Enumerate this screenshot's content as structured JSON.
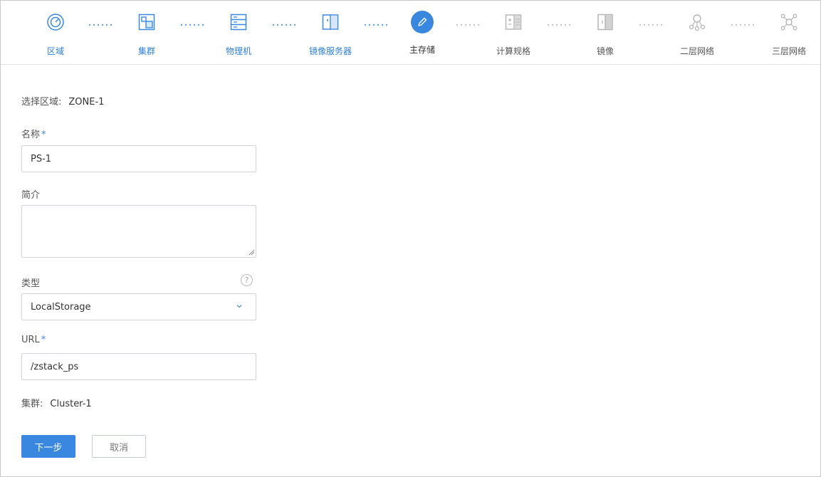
{
  "wizard": {
    "steps": [
      {
        "label": "区域",
        "icon": "zone-icon",
        "state": "done"
      },
      {
        "label": "集群",
        "icon": "cluster-icon",
        "state": "done"
      },
      {
        "label": "物理机",
        "icon": "host-icon",
        "state": "done"
      },
      {
        "label": "镜像服务器",
        "icon": "backup-storage-icon",
        "state": "done"
      },
      {
        "label": "主存储",
        "icon": "pencil-icon",
        "state": "current"
      },
      {
        "label": "计算规格",
        "icon": "instance-offering-icon",
        "state": "pending"
      },
      {
        "label": "镜像",
        "icon": "image-icon",
        "state": "pending"
      },
      {
        "label": "二层网络",
        "icon": "l2-network-icon",
        "state": "pending"
      },
      {
        "label": "三层网络",
        "icon": "l3-network-icon",
        "state": "pending"
      }
    ],
    "colors": {
      "active": "#3a87e0",
      "pending": "#b8b8b8"
    }
  },
  "form": {
    "zone": {
      "label": "选择区域:",
      "value": "ZONE-1"
    },
    "name": {
      "label": "名称",
      "required_mark": "*",
      "value": "PS-1"
    },
    "description": {
      "label": "简介",
      "value": ""
    },
    "type": {
      "label": "类型",
      "value": "LocalStorage",
      "help": "?"
    },
    "url": {
      "label": "URL",
      "required_mark": "*",
      "value": "/zstack_ps"
    },
    "cluster": {
      "label": "集群:",
      "value": "Cluster-1"
    }
  },
  "buttons": {
    "next": "下一步",
    "cancel": "取消"
  }
}
